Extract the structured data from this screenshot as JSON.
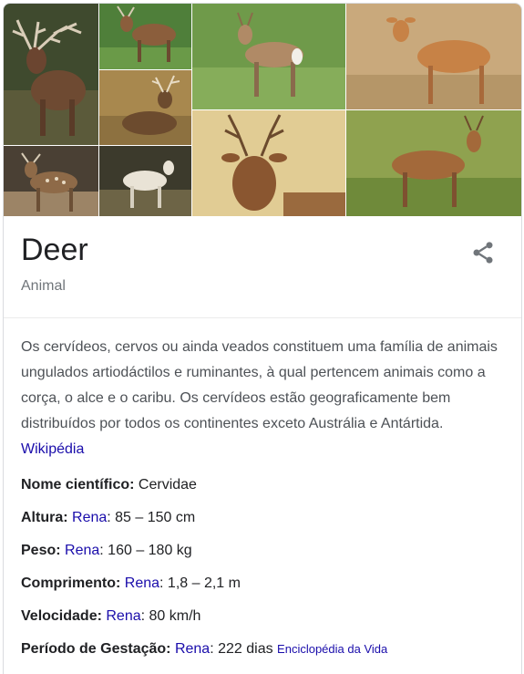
{
  "entity": {
    "title": "Deer",
    "subtitle": "Animal"
  },
  "icons": {
    "share": "share-icon"
  },
  "gallery": {
    "images": [
      {
        "name": "red-deer-stag",
        "alt": "Red deer stag"
      },
      {
        "name": "deer-in-grass",
        "alt": "Deer on grass"
      },
      {
        "name": "stag-lying",
        "alt": "Stag lying down"
      },
      {
        "name": "fallow-deer",
        "alt": "Spotted deer"
      },
      {
        "name": "white-deer",
        "alt": "White deer"
      },
      {
        "name": "roe-deer",
        "alt": "Deer in meadow"
      },
      {
        "name": "doe-standing",
        "alt": "Doe standing"
      },
      {
        "name": "stag-portrait",
        "alt": "Stag portrait"
      },
      {
        "name": "deer-walking",
        "alt": "Deer walking"
      }
    ]
  },
  "description": {
    "text": "Os cervídeos, cervos ou ainda veados constituem uma família de animais ungulados artiodáctilos e ruminantes, à qual pertencem animais como a corça, o alce e o caribu. Os cervídeos estão geograficamente bem distribuídos por todos os continentes exceto Austrália e Antártida. ",
    "source_link": "Wikipédia"
  },
  "facts": [
    {
      "label": "Nome científico:",
      "value": " Cervidae"
    },
    {
      "label": "Altura:",
      "link": "Rena",
      "value": ": 85 – 150 cm"
    },
    {
      "label": "Peso:",
      "link": "Rena",
      "value": ": 160 – 180 kg"
    },
    {
      "label": "Comprimento:",
      "link": "Rena",
      "value": ": 1,8 – 2,1 m"
    },
    {
      "label": "Velocidade:",
      "link": "Rena",
      "value": ": 80 km/h"
    },
    {
      "label": "Período de Gestação:",
      "link": "Rena",
      "value": ": 222 dias",
      "source": "Enciclopédia da Vida"
    }
  ],
  "colors": {
    "link": "#1a0dab",
    "subtle": "#70757a",
    "text": "#202124"
  }
}
